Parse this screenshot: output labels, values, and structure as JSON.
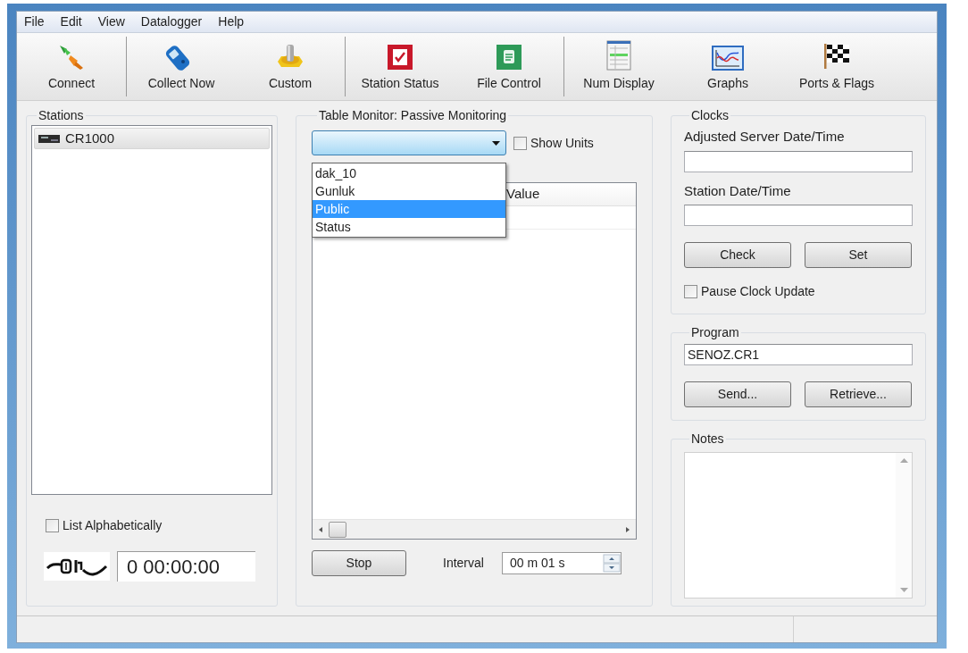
{
  "menu": [
    "File",
    "Edit",
    "View",
    "Datalogger",
    "Help"
  ],
  "toolbar": [
    {
      "kind": "plug",
      "label": "Connect"
    },
    {
      "kind": "separator"
    },
    {
      "kind": "phone",
      "label": "Collect Now"
    },
    {
      "kind": "gear",
      "label": "Custom"
    },
    {
      "kind": "separator"
    },
    {
      "kind": "status",
      "label": "Station Status"
    },
    {
      "kind": "file",
      "label": "File Control"
    },
    {
      "kind": "separator"
    },
    {
      "kind": "numdisplay",
      "label": "Num Display"
    },
    {
      "kind": "graph",
      "label": "Graphs"
    },
    {
      "kind": "flags",
      "label": "Ports & Flags"
    }
  ],
  "stations": {
    "title": "Stations",
    "items": [
      {
        "name": "CR1000",
        "selected": true
      }
    ],
    "list_alphabetically": {
      "label": "List Alphabetically",
      "checked": false
    },
    "connection_timer": "0 00:00:00"
  },
  "table_monitor": {
    "title": "Table Monitor: Passive Monitoring",
    "table_dropdown": {
      "expanded": true,
      "options": [
        {
          "label": "dak_10",
          "selected": false
        },
        {
          "label": "Gunluk",
          "selected": false
        },
        {
          "label": "Public",
          "selected": true
        },
        {
          "label": "Status",
          "selected": false
        }
      ]
    },
    "show_units": {
      "label": "Show Units",
      "checked": false
    },
    "columns": [
      "Value"
    ],
    "stop_button": "Stop",
    "interval_label": "Interval",
    "interval_value": "00 m 01 s"
  },
  "clocks": {
    "title": "Clocks",
    "server_label": "Adjusted Server Date/Time",
    "station_label": "Station Date/Time",
    "buttons": [
      "Check",
      "Set"
    ],
    "pause_clock_update": {
      "label": "Pause Clock Update",
      "checked": false
    }
  },
  "program": {
    "title": "Program",
    "file": "SENOZ.CR1",
    "buttons": [
      "Send...",
      "Retrieve..."
    ]
  },
  "notes": {
    "title": "Notes"
  }
}
